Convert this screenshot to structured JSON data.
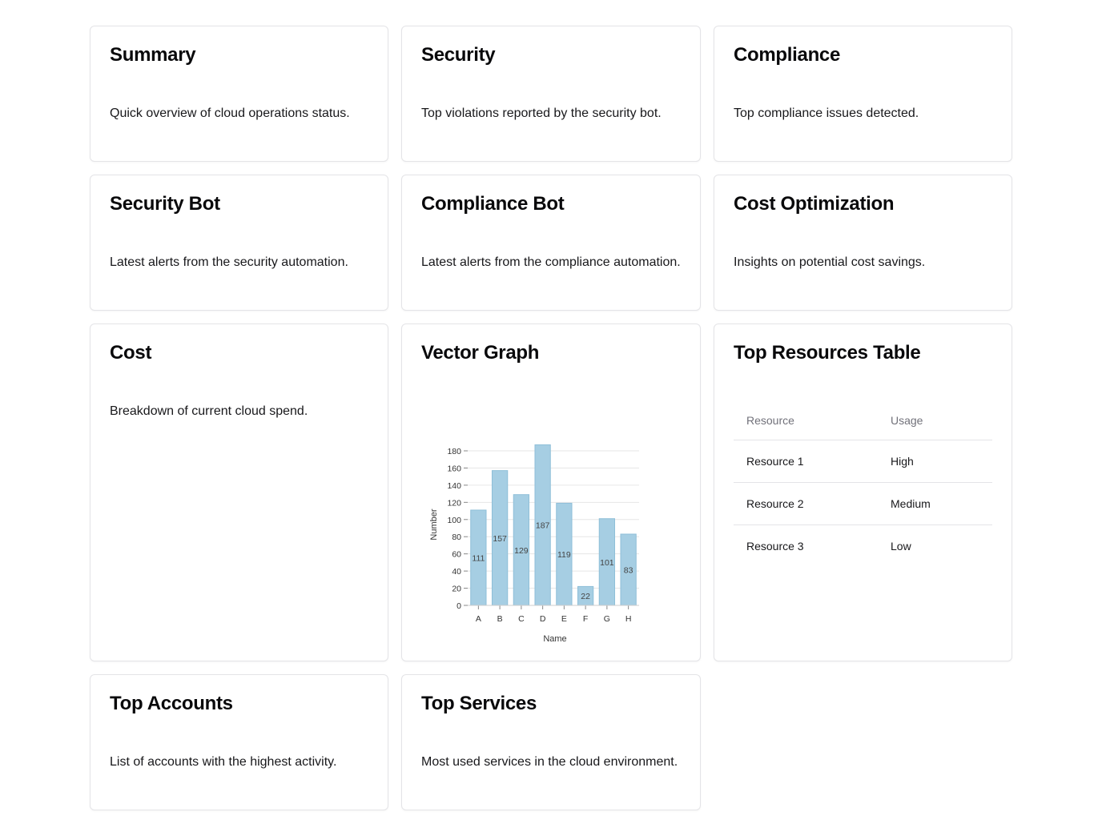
{
  "cards": {
    "summary": {
      "title": "Summary",
      "description": "Quick overview of cloud operations status."
    },
    "security": {
      "title": "Security",
      "description": "Top violations reported by the security bot."
    },
    "compliance": {
      "title": "Compliance",
      "description": "Top compliance issues detected."
    },
    "security_bot": {
      "title": "Security Bot",
      "description": "Latest alerts from the security automation."
    },
    "compliance_bot": {
      "title": "Compliance Bot",
      "description": "Latest alerts from the compliance automation."
    },
    "cost_optimization": {
      "title": "Cost Optimization",
      "description": "Insights on potential cost savings."
    },
    "cost": {
      "title": "Cost",
      "description": "Breakdown of current cloud spend."
    },
    "vector_graph": {
      "title": "Vector Graph"
    },
    "top_resources": {
      "title": "Top Resources Table",
      "headers": [
        "Resource",
        "Usage"
      ],
      "rows": [
        [
          "Resource 1",
          "High"
        ],
        [
          "Resource 2",
          "Medium"
        ],
        [
          "Resource 3",
          "Low"
        ]
      ]
    },
    "top_accounts": {
      "title": "Top Accounts",
      "description": "List of accounts with the highest activity."
    },
    "top_services": {
      "title": "Top Services",
      "description": "Most used services in the cloud environment."
    }
  },
  "chart_data": {
    "type": "bar",
    "categories": [
      "A",
      "B",
      "C",
      "D",
      "E",
      "F",
      "G",
      "H"
    ],
    "values": [
      111,
      157,
      129,
      187,
      119,
      22,
      101,
      83
    ],
    "xlabel": "Name",
    "ylabel": "Number",
    "ylim": [
      0,
      180
    ],
    "yticks": [
      0,
      20,
      40,
      60,
      80,
      100,
      120,
      140,
      160,
      180
    ],
    "grid": true,
    "data_labels": true,
    "bar_color": "#a6cee3",
    "bar_stroke": "#8fbfd8"
  }
}
